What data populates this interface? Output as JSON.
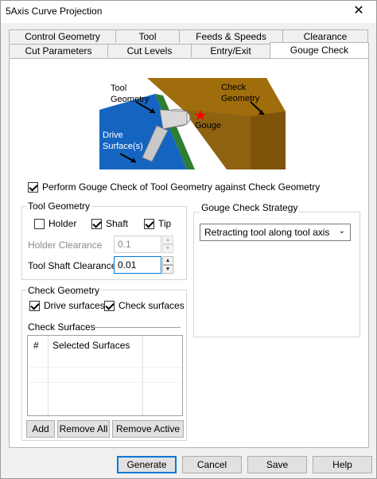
{
  "window": {
    "title": "5Axis Curve Projection",
    "close_glyph": "✕"
  },
  "tabs_row1": [
    {
      "label": "Control Geometry"
    },
    {
      "label": "Tool"
    },
    {
      "label": "Feeds & Speeds"
    },
    {
      "label": "Clearance"
    }
  ],
  "tabs_row2": [
    {
      "label": "Cut Parameters"
    },
    {
      "label": "Cut Levels"
    },
    {
      "label": "Entry/Exit"
    },
    {
      "label": "Gouge Check",
      "active": true
    }
  ],
  "illustration": {
    "tool_geometry_line1": "Tool",
    "tool_geometry_line2": "Geometry",
    "check_geometry_line1": "Check",
    "check_geometry_line2": "Geometry",
    "gouge": "Gouge",
    "drive_surfaces_line1": "Drive",
    "drive_surfaces_line2": "Surface(s)",
    "colors": {
      "check": "#b07a12",
      "drive": "#1565c0",
      "gouge": "#ff0000"
    }
  },
  "perform_gouge_check": {
    "label": "Perform Gouge Check of Tool Geometry against Check Geometry",
    "checked": true
  },
  "tool_geometry": {
    "title": "Tool Geometry",
    "holder": {
      "label": "Holder",
      "checked": false
    },
    "shaft": {
      "label": "Shaft",
      "checked": true
    },
    "tip": {
      "label": "Tip",
      "checked": true
    },
    "holder_clearance": {
      "label": "Holder Clearance",
      "value": "0.1"
    },
    "tool_shaft_clearance": {
      "label": "Tool Shaft Clearance",
      "value": "0.01"
    }
  },
  "gouge_check_strategy": {
    "title": "Gouge Check Strategy",
    "selected": "Retracting tool along tool axis"
  },
  "check_geometry": {
    "title": "Check Geometry",
    "drive_surfaces": {
      "label": "Drive surfaces",
      "checked": true
    },
    "check_surfaces": {
      "label": "Check surfaces",
      "checked": true
    },
    "check_surfaces_heading": "Check Surfaces",
    "columns": [
      "#",
      "Selected Surfaces"
    ],
    "buttons": {
      "add": "Add",
      "remove_all": "Remove All",
      "remove_active": "Remove Active"
    }
  },
  "footer": {
    "generate": "Generate",
    "cancel": "Cancel",
    "save": "Save",
    "help": "Help"
  }
}
